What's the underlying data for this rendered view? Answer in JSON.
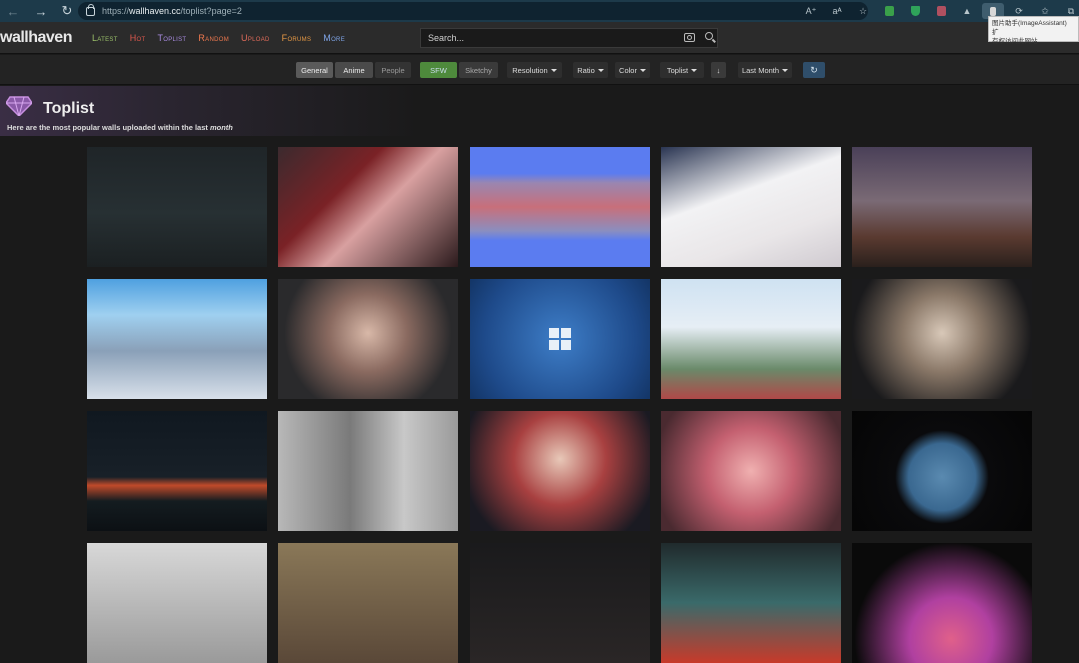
{
  "browser": {
    "url_prefix": "https://",
    "url_host": "wallhaven.cc",
    "url_path": "/toplist?page=2",
    "tooltip_line1": "图片助手(ImageAssistant) 扩",
    "tooltip_line2": "有权访问此网站",
    "ext_icons": [
      "read-aloud-icon",
      "translate-icon",
      "favorite-star-icon",
      "extension-green-icon",
      "shield-icon",
      "collections-icon",
      "triangle-icon",
      "image-assistant-icon",
      "copilot-icon",
      "favorites-icon",
      "collections-icon-2"
    ],
    "ext_ab": "A⁺",
    "ext_tr": "aᴬ"
  },
  "header": {
    "logo": "wallhaven",
    "nav": [
      {
        "label": "Latest",
        "color": "#9bc16a"
      },
      {
        "label": "Hot",
        "color": "#e0584e"
      },
      {
        "label": "Toplist",
        "color": "#a88be0"
      },
      {
        "label": "Random",
        "color": "#f0794f"
      },
      {
        "label": "Upload",
        "color": "#e06b5a"
      },
      {
        "label": "Forums",
        "color": "#e89a45"
      },
      {
        "label": "More",
        "color": "#7fa5e8"
      }
    ],
    "search_placeholder": "Search..."
  },
  "filters": {
    "general": "General",
    "anime": "Anime",
    "people": "People",
    "sfw": "SFW",
    "sketchy": "Sketchy",
    "resolution": "Resolution",
    "ratio": "Ratio",
    "color": "Color",
    "toplist": "Toplist",
    "order_icon": "↓",
    "range": "Last Month",
    "refresh_icon": "↻"
  },
  "toplist": {
    "title": "Toplist",
    "subtitle": "Here are the most popular walls uploaded within the last ",
    "subtitle_em": "month"
  },
  "thumbs": [
    {
      "name": "thumb-dark-night-street",
      "bg": "linear-gradient(180deg,#1f2528 0%,#273033 55%,#1b2022 100%)"
    },
    {
      "name": "thumb-anime-girl-red-room",
      "bg": "linear-gradient(135deg,#3b2a2e 0%,#7a2226 35%,#d8a0a0 55%,#2b1a1c 100%)"
    },
    {
      "name": "thumb-blue-pixel-mosaic",
      "bg": "linear-gradient(180deg,#5b7cf0 0%,#5b7cf0 22%,#9a86b0 30%,#c86f7a 50%,#8a8ec0 70%,#5b7cf0 78%,#5b7cf0 100%)"
    },
    {
      "name": "thumb-anime-girl-back",
      "bg": "linear-gradient(160deg,#2a3552 0%,#f2f2f4 40%,#e9e6e8 70%,#cfcad0 100%)"
    },
    {
      "name": "thumb-girl-dusk-field",
      "bg": "linear-gradient(180deg,#4a4058 0%,#7a6a75 45%,#5a3a30 75%,#2a201c 100%)"
    },
    {
      "name": "thumb-anime-street-houses",
      "bg": "linear-gradient(180deg,#4fa0e0 0%,#9fd0f0 30%,#8aa0b8 60%,#d8e0ea 100%)"
    },
    {
      "name": "thumb-girl-portrait",
      "bg": "radial-gradient(circle at 50% 45%,#d8b8a8 0%,#8a6a60 35%,#2a2a2c 75%)"
    },
    {
      "name": "thumb-windows-logo",
      "bg": "radial-gradient(circle at 50% 50%,#3e7ec8 0%,#1e4a8a 70%,#133566 100%)"
    },
    {
      "name": "thumb-anime-girl-court",
      "bg": "linear-gradient(180deg,#cfe2f2 0%,#e6eef5 40%,#6a8a6a 75%,#b04848 100%)"
    },
    {
      "name": "thumb-girl-white-outfit",
      "bg": "radial-gradient(circle at 50% 45%,#d8c8b8 0%,#8a7868 35%,#1a1a1c 80%)"
    },
    {
      "name": "thumb-mountain-sunset",
      "bg": "linear-gradient(180deg,#101820 0%,#182028 55%,#c04a2a 62%,#141c20 75%,#0c1014 100%)"
    },
    {
      "name": "thumb-girl-stone-pillar",
      "bg": "linear-gradient(90deg,#b8b8b8 0%,#7a7a7a 40%,#c8c8c8 70%,#9a9a9a 100%)"
    },
    {
      "name": "thumb-girl-kimono",
      "bg": "radial-gradient(circle at 50% 40%,#e8c8b8 0%,#a84040 40%,#1a1a22 85%)"
    },
    {
      "name": "thumb-girl-pink-controller",
      "bg": "radial-gradient(circle at 50% 50%,#f0b0b0 0%,#c46070 40%,#4a2a30 90%)"
    },
    {
      "name": "thumb-earth-planet",
      "bg": "radial-gradient(circle at 50% 55%,#5a8ab0 0%,#3a6890 30%,#0a0a0c 42%,#050505 100%)"
    },
    {
      "name": "thumb-sneakers",
      "bg": "linear-gradient(180deg,#d8d8d8 0%,#9a9a9a 100%)"
    },
    {
      "name": "thumb-anime-girl-bunny",
      "bg": "linear-gradient(180deg,#8a7858 0%,#5a4838 100%)"
    },
    {
      "name": "thumb-dark-abstract",
      "bg": "linear-gradient(180deg,#1a1a1c 0%,#2a2626 100%)"
    },
    {
      "name": "thumb-colorful-sphere",
      "bg": "linear-gradient(180deg,#202a2c 0%,#3a6a6a 50%,#c83a2a 100%)"
    },
    {
      "name": "thumb-colorful-splash",
      "bg": "radial-gradient(circle at 55% 80%,#e0608a 0%,#b040a0 30%,#0a0a0a 70%)"
    }
  ]
}
